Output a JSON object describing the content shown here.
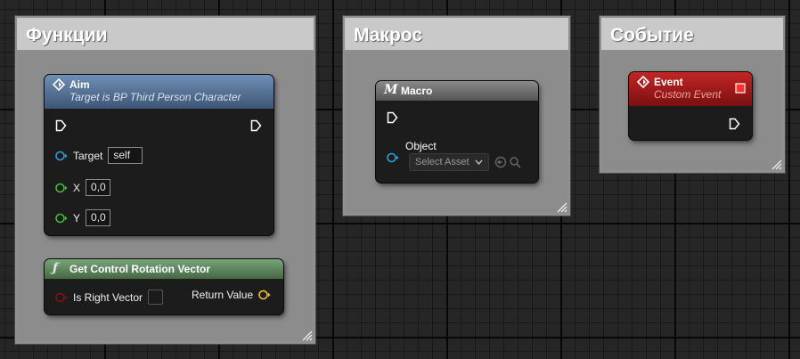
{
  "comments": {
    "functions": {
      "title": "Функции"
    },
    "macro": {
      "title": "Макрос"
    },
    "event": {
      "title": "Событие"
    }
  },
  "nodes": {
    "aim": {
      "title": "Aim",
      "subtitle": "Target is BP Third Person Character",
      "header_color": "#5a7aa0",
      "pins": {
        "target": {
          "label": "Target",
          "value": "self"
        },
        "x": {
          "label": "X",
          "value": "0,0"
        },
        "y": {
          "label": "Y",
          "value": "0,0"
        }
      }
    },
    "get_control_rotation_vector": {
      "title": "Get Control Rotation Vector",
      "header_color": "#5f8a5e",
      "pins": {
        "is_right_vector": {
          "label": "Is Right Vector"
        },
        "return_value": {
          "label": "Return Value"
        }
      }
    },
    "macro": {
      "title": "Macro",
      "header_color": "#7a7a7a",
      "pins": {
        "object": {
          "label": "Object",
          "placeholder": "Select Asset"
        }
      }
    },
    "event": {
      "title": "Event",
      "subtitle": "Custom Event",
      "header_color": "#a11d1d"
    }
  },
  "colors": {
    "object_pin": "#2aa0e0",
    "float_pin": "#39c22d",
    "bool_pin": "#8b0d0d",
    "vector_pin": "#f2c229",
    "exec_pin": "#ffffff"
  },
  "icons": {
    "function_node": "diamond-event-icon",
    "pure_function": "function-f-icon",
    "macro": "macro-m-icon",
    "event": "diamond-event-icon",
    "delegate": "delegate-square-icon"
  }
}
